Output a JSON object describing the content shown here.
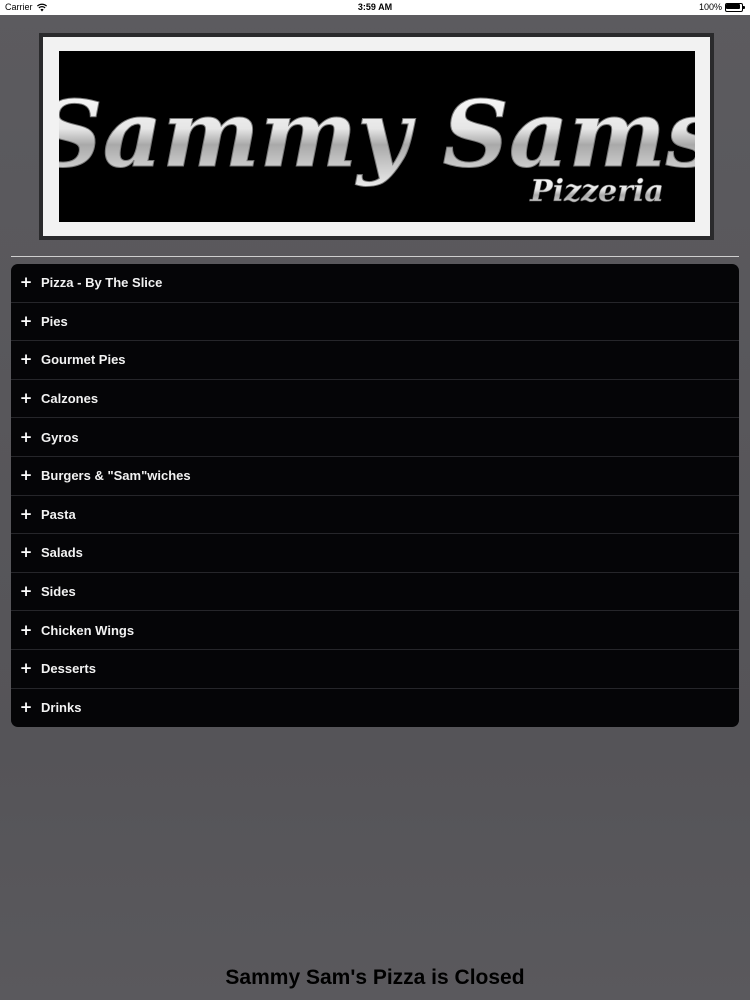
{
  "status_bar": {
    "carrier": "Carrier",
    "time": "3:59 AM",
    "battery_percent": "100%",
    "battery_level": 1.0,
    "wifi_icon": "wifi-icon",
    "battery_icon": "battery-icon"
  },
  "logo": {
    "title_line1": "Sammy Sams",
    "subtitle": "Pizzeria"
  },
  "menu": {
    "expand_icon": "plus-icon",
    "items": [
      {
        "label": "Pizza - By The Slice"
      },
      {
        "label": "Pies"
      },
      {
        "label": "Gourmet Pies"
      },
      {
        "label": "Calzones"
      },
      {
        "label": "Gyros"
      },
      {
        "label": "Burgers & \"Sam\"wiches"
      },
      {
        "label": "Pasta"
      },
      {
        "label": "Salads"
      },
      {
        "label": "Sides"
      },
      {
        "label": "Chicken Wings"
      },
      {
        "label": "Desserts"
      },
      {
        "label": "Drinks"
      }
    ]
  },
  "footer": {
    "status_message": "Sammy Sam's Pizza is Closed"
  },
  "colors": {
    "background": "#58575b",
    "menu_background": "#050507",
    "menu_text": "#f2f2f2",
    "status_bar": "#ffffff"
  }
}
